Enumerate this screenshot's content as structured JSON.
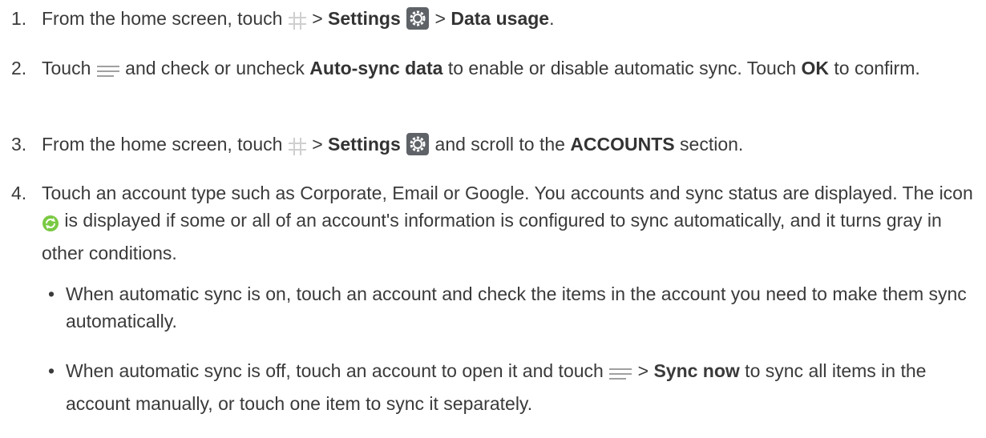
{
  "steps": [
    {
      "num": "1.",
      "t1": "From the home screen, touch",
      "t2": " > ",
      "b1": "Settings",
      "t3": " > ",
      "b2": "Data usage",
      "t4": "."
    },
    {
      "num": "2.",
      "t1": "Touch",
      "t2": " and check or uncheck ",
      "b1": "Auto-sync data",
      "t3": " to enable or disable automatic sync. Touch ",
      "b2": "OK",
      "t4": " to confirm."
    },
    {
      "num": "3.",
      "t1": "From the home screen, touch",
      "t2": " > ",
      "b1": "Settings",
      "t3": " and scroll to the ",
      "b2": "ACCOUNTS",
      "t4": " section."
    },
    {
      "num": "4.",
      "t1": "Touch an account type such as Corporate, Email or Google. You accounts and sync status are displayed. The icon",
      "t2": " is displayed if some or all of an account's information is configured to sync automatically, and it turns gray in other conditions."
    }
  ],
  "bullets": [
    {
      "dot": "•",
      "t1": "When automatic sync is on, touch an account and check the items in the account you need to make them sync automatically."
    },
    {
      "dot": "•",
      "t1": "When automatic sync is off, touch an account to open it and touch",
      "t2": " > ",
      "b1": "Sync now",
      "t3": " to sync all items in the account manually, or touch one item to sync it separately."
    }
  ],
  "icons": {
    "apps": "apps-grid-icon",
    "settings": "settings-gear-icon",
    "menu": "menu-lines-icon",
    "sync": "sync-icon",
    "settings_color": "#5f6368",
    "sync_color": "#7ac943",
    "grid_color": "#cfcfcf"
  }
}
